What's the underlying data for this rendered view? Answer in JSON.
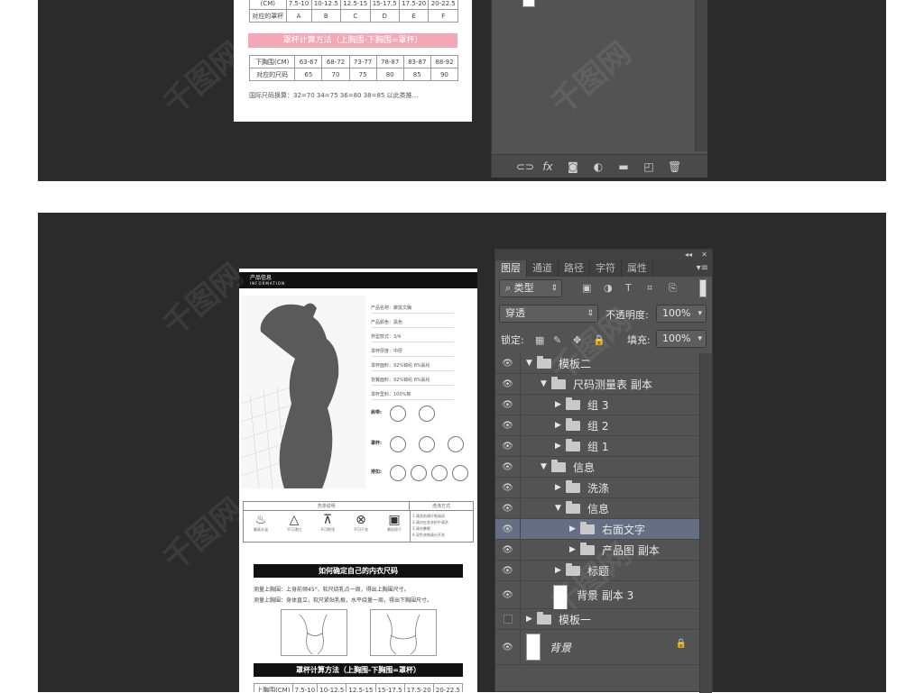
{
  "top_doc": {
    "header_row": [
      "(CM)",
      "7.5-10",
      "10-12.5",
      "12.5-15",
      "15-17.5",
      "17.5-20",
      "20-22.5"
    ],
    "cup_row": [
      "对应的罩杯",
      "A",
      "B",
      "C",
      "D",
      "E",
      "F"
    ],
    "band_title": "罩杯计算方法（上胸围-下胸围=罩杯）",
    "under_row": [
      "下胸围(CM)",
      "63-67",
      "68-72",
      "73-77",
      "78-87",
      "83-87",
      "88-92"
    ],
    "size_row": [
      "对应的尺码",
      "65",
      "70",
      "75",
      "80",
      "85",
      "90"
    ],
    "note": "国际尺码换算：32=70  34=75  36=80  38=85 以此类推..."
  },
  "bottom_doc": {
    "header_title": "产品信息",
    "header_sub": "INFORMATION",
    "specs": [
      "产品名称：聚拢文胸",
      "产品颜色：黑色",
      "杯型款式：3/4",
      "罩杯厚度：中厚",
      "罩杯面料：92%锦纶 8%氨纶",
      "背翼面料：92%锦纶 8%氨纶",
      "罩杯里料：100%棉"
    ],
    "option_labels": [
      "肩带:",
      "罩杯:",
      "排扣:"
    ],
    "care_head_left": "洗涤说明",
    "care_head_right": "洗涤方式",
    "care_items": [
      {
        "sym": "♨",
        "label": "最高水温"
      },
      {
        "sym": "△",
        "label": "不可漂白"
      },
      {
        "sym": "⊼",
        "label": "不可熨烫"
      },
      {
        "sym": "⊗",
        "label": "不可干洗"
      },
      {
        "sym": "▣",
        "label": "悬挂晾干"
      }
    ],
    "care_notes": [
      "1.清洗前请仔细阅读",
      "2.请勿在洗衣机中清洗",
      "3.请勿暴晒",
      "4.深色衣物请分开洗"
    ],
    "how_title": "如何确定自己的内衣尺码",
    "measure_1": "测量上胸围：上身前倾45°，软尺绕乳点一周，得出上胸围尺寸。",
    "measure_2": "测量上胸围：身体直立，软尺紧贴乳根，水平绕量一周，得出下胸围尺寸。",
    "cup_title": "罩杯计算方法（上胸围-下胸围=罩杯）",
    "bottom_row": [
      "上胸围(CM)",
      "7.5-10",
      "10-12.5",
      "12.5-15",
      "15-17.5",
      "17.5-20",
      "20-22.5"
    ]
  },
  "layers_panel": {
    "tabs": [
      "图层",
      "通道",
      "路径",
      "字符",
      "属性"
    ],
    "collapse_icon": "double-chevron-left-icon",
    "close_icon": "close-icon",
    "filter_type": "类型",
    "blend_mode": "穿透",
    "opacity_label": "不透明度:",
    "opacity_value": "100%",
    "lock_label": "锁定:",
    "fill_label": "填充:",
    "fill_value": "100%",
    "layers": [
      {
        "name": "模板二",
        "kind": "group",
        "expanded": true,
        "indent": 0,
        "visible": true
      },
      {
        "name": "尺码测量表 副本",
        "kind": "group",
        "expanded": true,
        "indent": 1,
        "visible": true
      },
      {
        "name": "组 3",
        "kind": "group",
        "expanded": false,
        "indent": 2,
        "visible": true
      },
      {
        "name": "组 2",
        "kind": "group",
        "expanded": false,
        "indent": 2,
        "visible": true
      },
      {
        "name": "组 1",
        "kind": "group",
        "expanded": false,
        "indent": 2,
        "visible": true
      },
      {
        "name": "信息",
        "kind": "group",
        "expanded": true,
        "indent": 1,
        "visible": true
      },
      {
        "name": "洗涤",
        "kind": "group",
        "expanded": false,
        "indent": 2,
        "visible": true
      },
      {
        "name": "信息",
        "kind": "group",
        "expanded": true,
        "indent": 2,
        "visible": true
      },
      {
        "name": "右面文字",
        "kind": "group",
        "expanded": false,
        "indent": 3,
        "visible": true,
        "selected": true
      },
      {
        "name": "产品图 副本",
        "kind": "group",
        "expanded": false,
        "indent": 3,
        "visible": true
      },
      {
        "name": "标题",
        "kind": "group",
        "expanded": false,
        "indent": 2,
        "visible": true
      },
      {
        "name": "背景 副本 3",
        "kind": "layer",
        "indent": 1,
        "visible": true
      },
      {
        "name": "模板一",
        "kind": "group",
        "expanded": false,
        "indent": 0,
        "visible": false
      },
      {
        "name": "背景",
        "kind": "background",
        "indent": 0,
        "visible": true,
        "locked": true
      }
    ]
  }
}
